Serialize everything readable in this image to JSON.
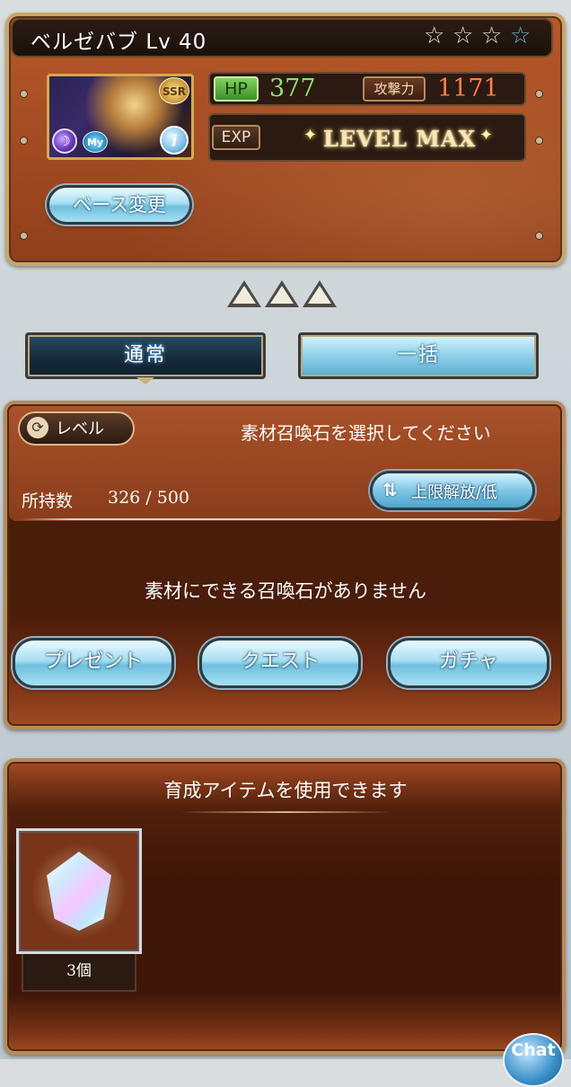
{
  "character": {
    "name": "ベルゼバブ",
    "level_text": "Lv 40",
    "rarity": "SSR",
    "stars": {
      "filled_color": "#5fb6e8",
      "empty_color": "#efe7d6",
      "total": 4,
      "filled": 1
    },
    "my_badge": "My",
    "info_glyph": "i",
    "element_icon": "dark-element-icon",
    "hp_label": "HP",
    "hp_value": "377",
    "atk_label": "攻撃力",
    "atk_value": "1171",
    "exp_label": "EXP",
    "exp_status": "LEVEL MAX",
    "base_change_label": "ベース変更"
  },
  "tabs": {
    "normal_label": "通常",
    "bulk_label": "一括"
  },
  "material": {
    "level_button_label": "レベル",
    "select_message": "素材召喚石を選択してください",
    "owned_label": "所持数",
    "owned_value": "326 / 500",
    "sort_label": "上限解放/低",
    "empty_message": "素材にできる召喚石がありません",
    "links": [
      "プレゼント",
      "クエスト",
      "ガチャ"
    ]
  },
  "items": {
    "message": "育成アイテムを使用できます",
    "list": [
      {
        "icon": "crystal-icon",
        "count": "3個"
      }
    ]
  },
  "chat_label": "Chat",
  "colors": {
    "hp_value": "#8be36a",
    "atk_value": "#ff7e4a",
    "panel": "#a24a22",
    "accent_blue": "#6fbfdd"
  }
}
